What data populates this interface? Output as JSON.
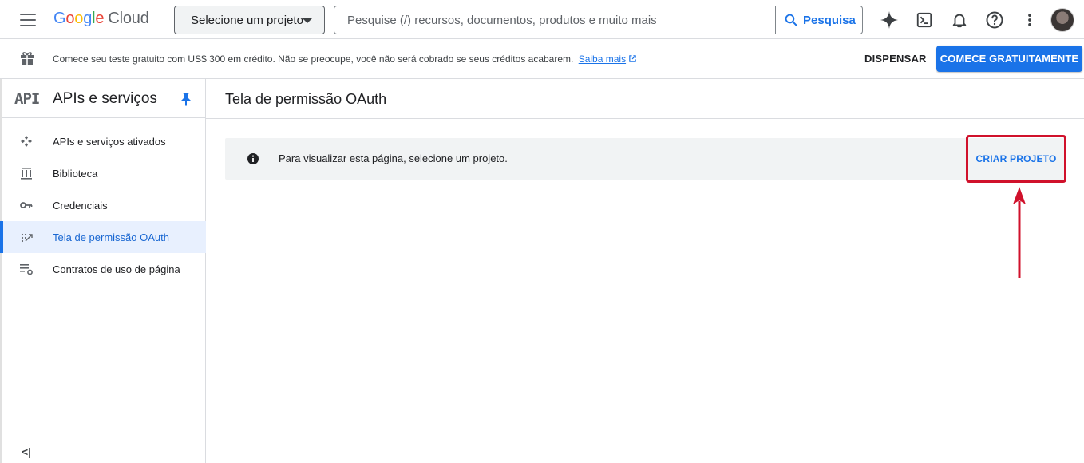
{
  "header": {
    "logo_parts": [
      "G",
      "o",
      "o",
      "g",
      "l",
      "e"
    ],
    "logo_suffix": "Cloud",
    "project_picker_label": "Selecione um projeto",
    "search_placeholder": "Pesquise (/) recursos, documentos, produtos e muito mais",
    "search_button_label": "Pesquisa",
    "icons": [
      "gemini-sparkle-icon",
      "cloud-shell-icon",
      "notifications-bell-icon",
      "help-icon",
      "more-vert-icon"
    ]
  },
  "promo": {
    "text": "Comece seu teste gratuito com US$ 300 em crédito. Não se preocupe, você não será cobrado se seus créditos acabarem.",
    "link": "Saiba mais",
    "dismiss_label": "DISPENSAR",
    "cta_label": "COMECE GRATUITAMENTE"
  },
  "sidebar": {
    "logo_text": "API",
    "title": "APIs e serviços",
    "items": [
      {
        "label": "APIs e serviços ativados",
        "icon": "apis-diamond-icon"
      },
      {
        "label": "Biblioteca",
        "icon": "library-icon"
      },
      {
        "label": "Credenciais",
        "icon": "key-icon"
      },
      {
        "label": "Tela de permissão OAuth",
        "icon": "oauth-consent-icon",
        "active": true
      },
      {
        "label": "Contratos de uso de página",
        "icon": "page-usage-settings-icon"
      }
    ],
    "collapse_label": "<|"
  },
  "main": {
    "title": "Tela de permissão OAuth",
    "notice_text": "Para visualizar esta página, selecione um projeto.",
    "create_project_label": "CRIAR PROJETO"
  },
  "colors": {
    "accent": "#1a73e8",
    "highlight_border": "#d0112b",
    "notice_bg": "#f1f3f4"
  }
}
